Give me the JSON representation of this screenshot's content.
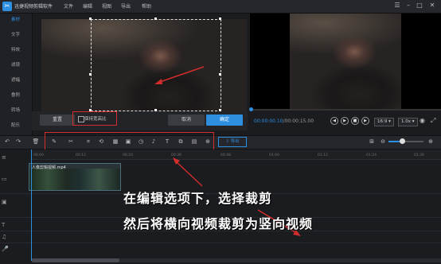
{
  "titlebar": {
    "app_title": "迅捷视频剪辑软件",
    "menus": [
      "文件",
      "编辑",
      "视图",
      "导出",
      "帮助"
    ]
  },
  "sidebar": {
    "items": [
      "素材",
      "文字",
      "特效",
      "滤镜",
      "遮幅",
      "叠附",
      "转场",
      "配乐"
    ]
  },
  "crop_panel": {
    "reset_label": "重置",
    "keep_ratio_label": "保持宽高比",
    "keep_ratio_checked": false,
    "cancel_label": "取消",
    "confirm_label": "确定"
  },
  "player": {
    "current_time": "00:00:00.10",
    "total_time": "00:00:15.00",
    "aspect_ratio": "16:9",
    "speed": "1.0x"
  },
  "toolbar": {
    "export_label": "导出"
  },
  "timeline": {
    "ruler_ticks": [
      "00:00",
      "00:12",
      "00:24",
      "00:36",
      "00:48",
      "01:00",
      "01:12",
      "01:24",
      "01:36",
      "01:48",
      "02:00"
    ],
    "clip_name": "人像剪辑视频.mp4"
  },
  "annotation": {
    "line1": "在编辑选项下，选择裁剪",
    "line2": "然后将横向视频裁剪为竖向视频"
  },
  "colors": {
    "accent": "#2e8ee0",
    "highlight_red": "#d12d2d",
    "background": "#1b1c20"
  }
}
